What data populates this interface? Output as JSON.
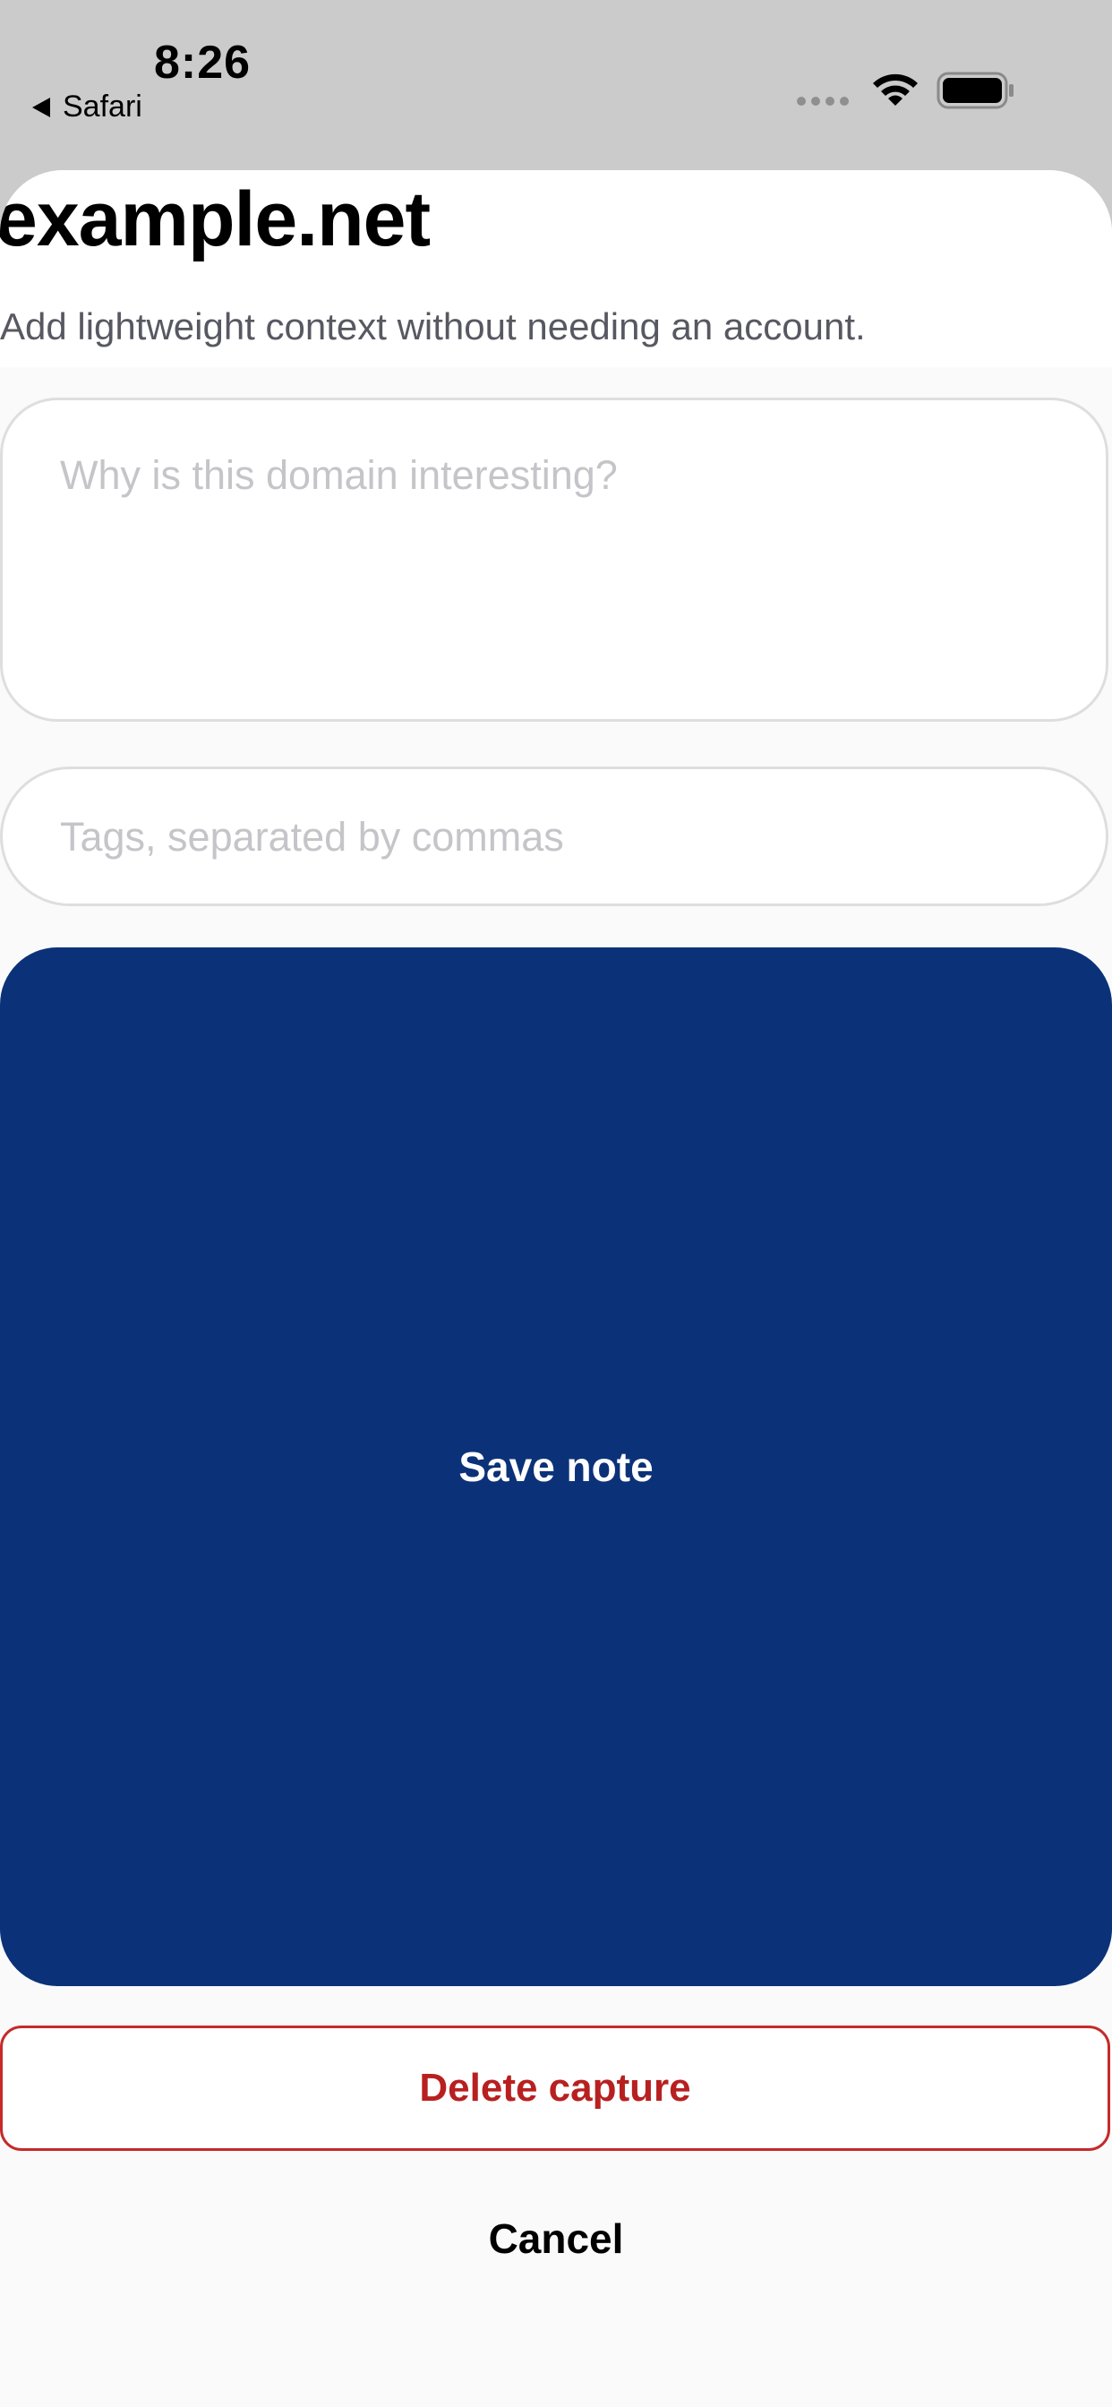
{
  "status_bar": {
    "time": "8:26",
    "back_label": "Safari"
  },
  "sheet": {
    "domain": "example.net",
    "subtitle": "Add lightweight context without needing an account.",
    "note_placeholder": "Why is this domain interesting?",
    "tags_placeholder": "Tags, separated by commas",
    "save_label": "Save note",
    "delete_label": "Delete capture",
    "cancel_label": "Cancel"
  },
  "colors": {
    "primary": "#0b3279",
    "danger": "#c62a2a"
  }
}
